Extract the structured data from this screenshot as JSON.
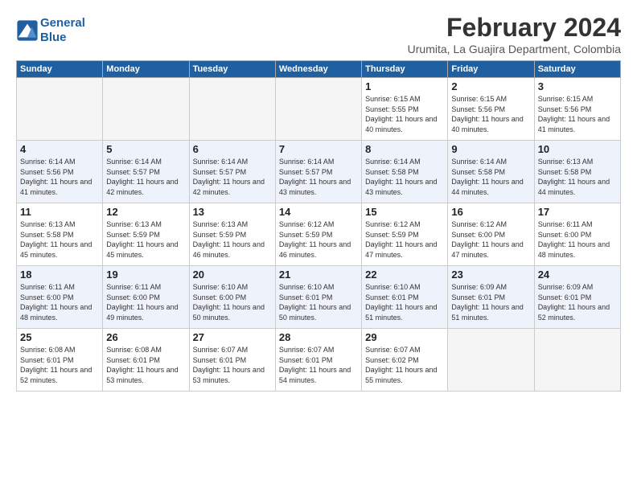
{
  "header": {
    "logo_line1": "General",
    "logo_line2": "Blue",
    "month": "February 2024",
    "location": "Urumita, La Guajira Department, Colombia"
  },
  "weekdays": [
    "Sunday",
    "Monday",
    "Tuesday",
    "Wednesday",
    "Thursday",
    "Friday",
    "Saturday"
  ],
  "weeks": [
    [
      {
        "day": "",
        "empty": true
      },
      {
        "day": "",
        "empty": true
      },
      {
        "day": "",
        "empty": true
      },
      {
        "day": "",
        "empty": true
      },
      {
        "day": "1",
        "sunrise": "6:15 AM",
        "sunset": "5:55 PM",
        "daylight": "11 hours and 40 minutes."
      },
      {
        "day": "2",
        "sunrise": "6:15 AM",
        "sunset": "5:56 PM",
        "daylight": "11 hours and 40 minutes."
      },
      {
        "day": "3",
        "sunrise": "6:15 AM",
        "sunset": "5:56 PM",
        "daylight": "11 hours and 41 minutes."
      }
    ],
    [
      {
        "day": "4",
        "sunrise": "6:14 AM",
        "sunset": "5:56 PM",
        "daylight": "11 hours and 41 minutes."
      },
      {
        "day": "5",
        "sunrise": "6:14 AM",
        "sunset": "5:57 PM",
        "daylight": "11 hours and 42 minutes."
      },
      {
        "day": "6",
        "sunrise": "6:14 AM",
        "sunset": "5:57 PM",
        "daylight": "11 hours and 42 minutes."
      },
      {
        "day": "7",
        "sunrise": "6:14 AM",
        "sunset": "5:57 PM",
        "daylight": "11 hours and 43 minutes."
      },
      {
        "day": "8",
        "sunrise": "6:14 AM",
        "sunset": "5:58 PM",
        "daylight": "11 hours and 43 minutes."
      },
      {
        "day": "9",
        "sunrise": "6:14 AM",
        "sunset": "5:58 PM",
        "daylight": "11 hours and 44 minutes."
      },
      {
        "day": "10",
        "sunrise": "6:13 AM",
        "sunset": "5:58 PM",
        "daylight": "11 hours and 44 minutes."
      }
    ],
    [
      {
        "day": "11",
        "sunrise": "6:13 AM",
        "sunset": "5:58 PM",
        "daylight": "11 hours and 45 minutes."
      },
      {
        "day": "12",
        "sunrise": "6:13 AM",
        "sunset": "5:59 PM",
        "daylight": "11 hours and 45 minutes."
      },
      {
        "day": "13",
        "sunrise": "6:13 AM",
        "sunset": "5:59 PM",
        "daylight": "11 hours and 46 minutes."
      },
      {
        "day": "14",
        "sunrise": "6:12 AM",
        "sunset": "5:59 PM",
        "daylight": "11 hours and 46 minutes."
      },
      {
        "day": "15",
        "sunrise": "6:12 AM",
        "sunset": "5:59 PM",
        "daylight": "11 hours and 47 minutes."
      },
      {
        "day": "16",
        "sunrise": "6:12 AM",
        "sunset": "6:00 PM",
        "daylight": "11 hours and 47 minutes."
      },
      {
        "day": "17",
        "sunrise": "6:11 AM",
        "sunset": "6:00 PM",
        "daylight": "11 hours and 48 minutes."
      }
    ],
    [
      {
        "day": "18",
        "sunrise": "6:11 AM",
        "sunset": "6:00 PM",
        "daylight": "11 hours and 48 minutes."
      },
      {
        "day": "19",
        "sunrise": "6:11 AM",
        "sunset": "6:00 PM",
        "daylight": "11 hours and 49 minutes."
      },
      {
        "day": "20",
        "sunrise": "6:10 AM",
        "sunset": "6:00 PM",
        "daylight": "11 hours and 50 minutes."
      },
      {
        "day": "21",
        "sunrise": "6:10 AM",
        "sunset": "6:01 PM",
        "daylight": "11 hours and 50 minutes."
      },
      {
        "day": "22",
        "sunrise": "6:10 AM",
        "sunset": "6:01 PM",
        "daylight": "11 hours and 51 minutes."
      },
      {
        "day": "23",
        "sunrise": "6:09 AM",
        "sunset": "6:01 PM",
        "daylight": "11 hours and 51 minutes."
      },
      {
        "day": "24",
        "sunrise": "6:09 AM",
        "sunset": "6:01 PM",
        "daylight": "11 hours and 52 minutes."
      }
    ],
    [
      {
        "day": "25",
        "sunrise": "6:08 AM",
        "sunset": "6:01 PM",
        "daylight": "11 hours and 52 minutes."
      },
      {
        "day": "26",
        "sunrise": "6:08 AM",
        "sunset": "6:01 PM",
        "daylight": "11 hours and 53 minutes."
      },
      {
        "day": "27",
        "sunrise": "6:07 AM",
        "sunset": "6:01 PM",
        "daylight": "11 hours and 53 minutes."
      },
      {
        "day": "28",
        "sunrise": "6:07 AM",
        "sunset": "6:01 PM",
        "daylight": "11 hours and 54 minutes."
      },
      {
        "day": "29",
        "sunrise": "6:07 AM",
        "sunset": "6:02 PM",
        "daylight": "11 hours and 55 minutes."
      },
      {
        "day": "",
        "empty": true
      },
      {
        "day": "",
        "empty": true
      }
    ]
  ]
}
